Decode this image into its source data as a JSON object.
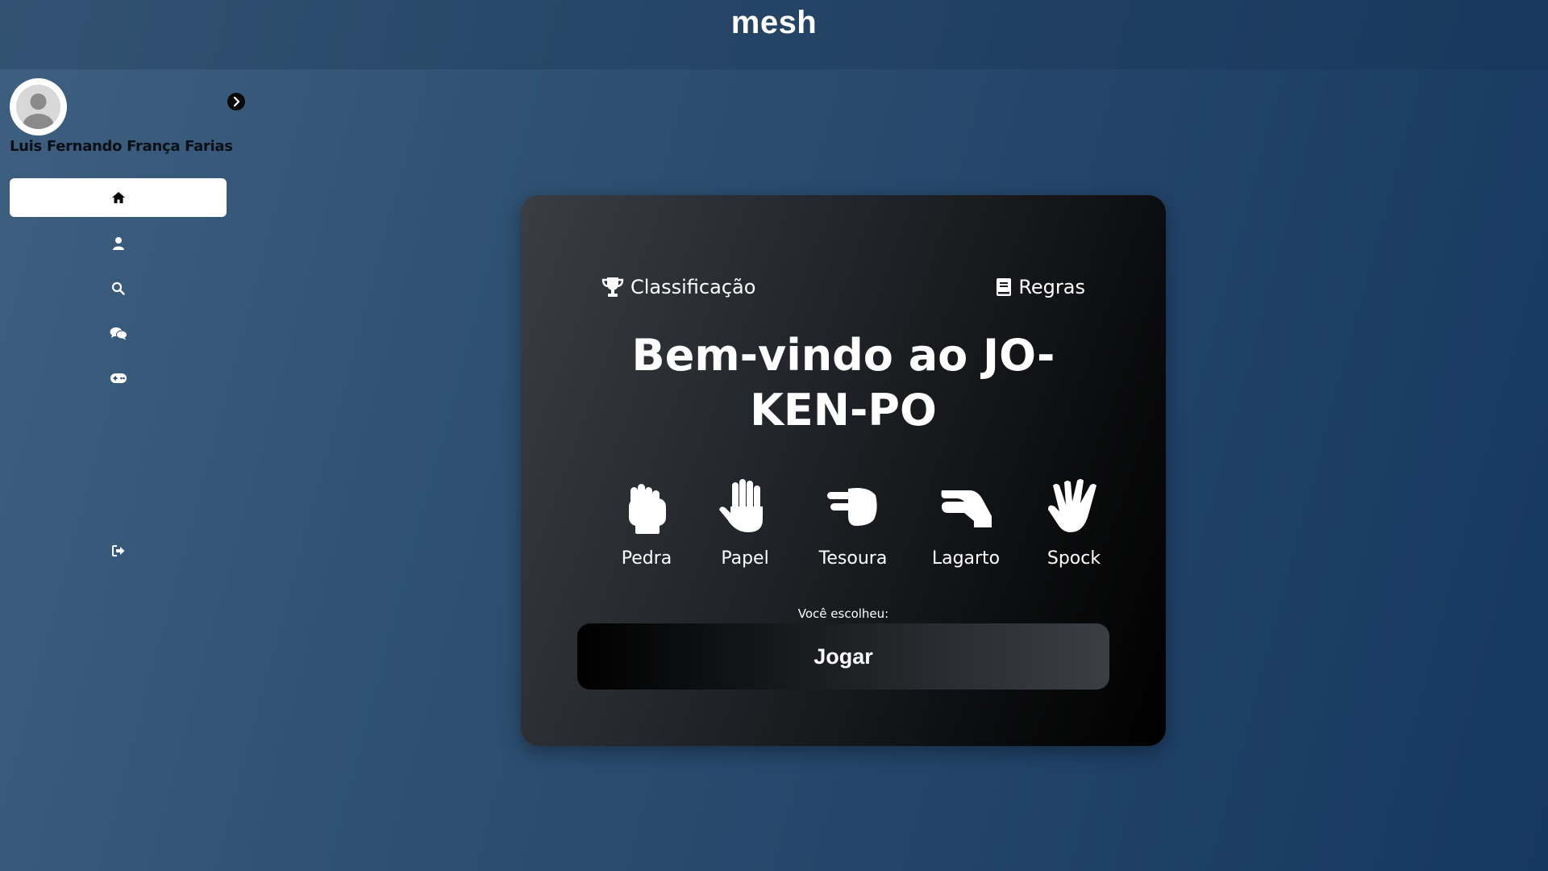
{
  "header": {
    "brand": "mesh"
  },
  "sidebar": {
    "user_name": "Luis Fernando França Farias",
    "items": [
      {
        "name": "home",
        "icon": "home-icon",
        "active": true
      },
      {
        "name": "profile",
        "icon": "user-icon",
        "active": false
      },
      {
        "name": "search",
        "icon": "search-icon",
        "active": false
      },
      {
        "name": "chat",
        "icon": "comments-icon",
        "active": false
      },
      {
        "name": "games",
        "icon": "gamepad-icon",
        "active": false
      }
    ],
    "logout_icon": "sign-out-icon"
  },
  "game": {
    "ranking_label": "Classificação",
    "rules_label": "Regras",
    "title": "Bem-vindo ao JO-KEN-PO",
    "choices": [
      {
        "label": "Pedra",
        "icon": "hand-rock-icon"
      },
      {
        "label": "Papel",
        "icon": "hand-paper-icon"
      },
      {
        "label": "Tesoura",
        "icon": "hand-scissors-icon"
      },
      {
        "label": "Lagarto",
        "icon": "hand-lizard-icon"
      },
      {
        "label": "Spock",
        "icon": "hand-spock-icon"
      }
    ],
    "chosen_label": "Você escolheu:",
    "play_label": "Jogar"
  },
  "colors": {
    "accent_white": "#ffffff",
    "card_dark": "#000000",
    "background_blue": "#2f5273"
  }
}
